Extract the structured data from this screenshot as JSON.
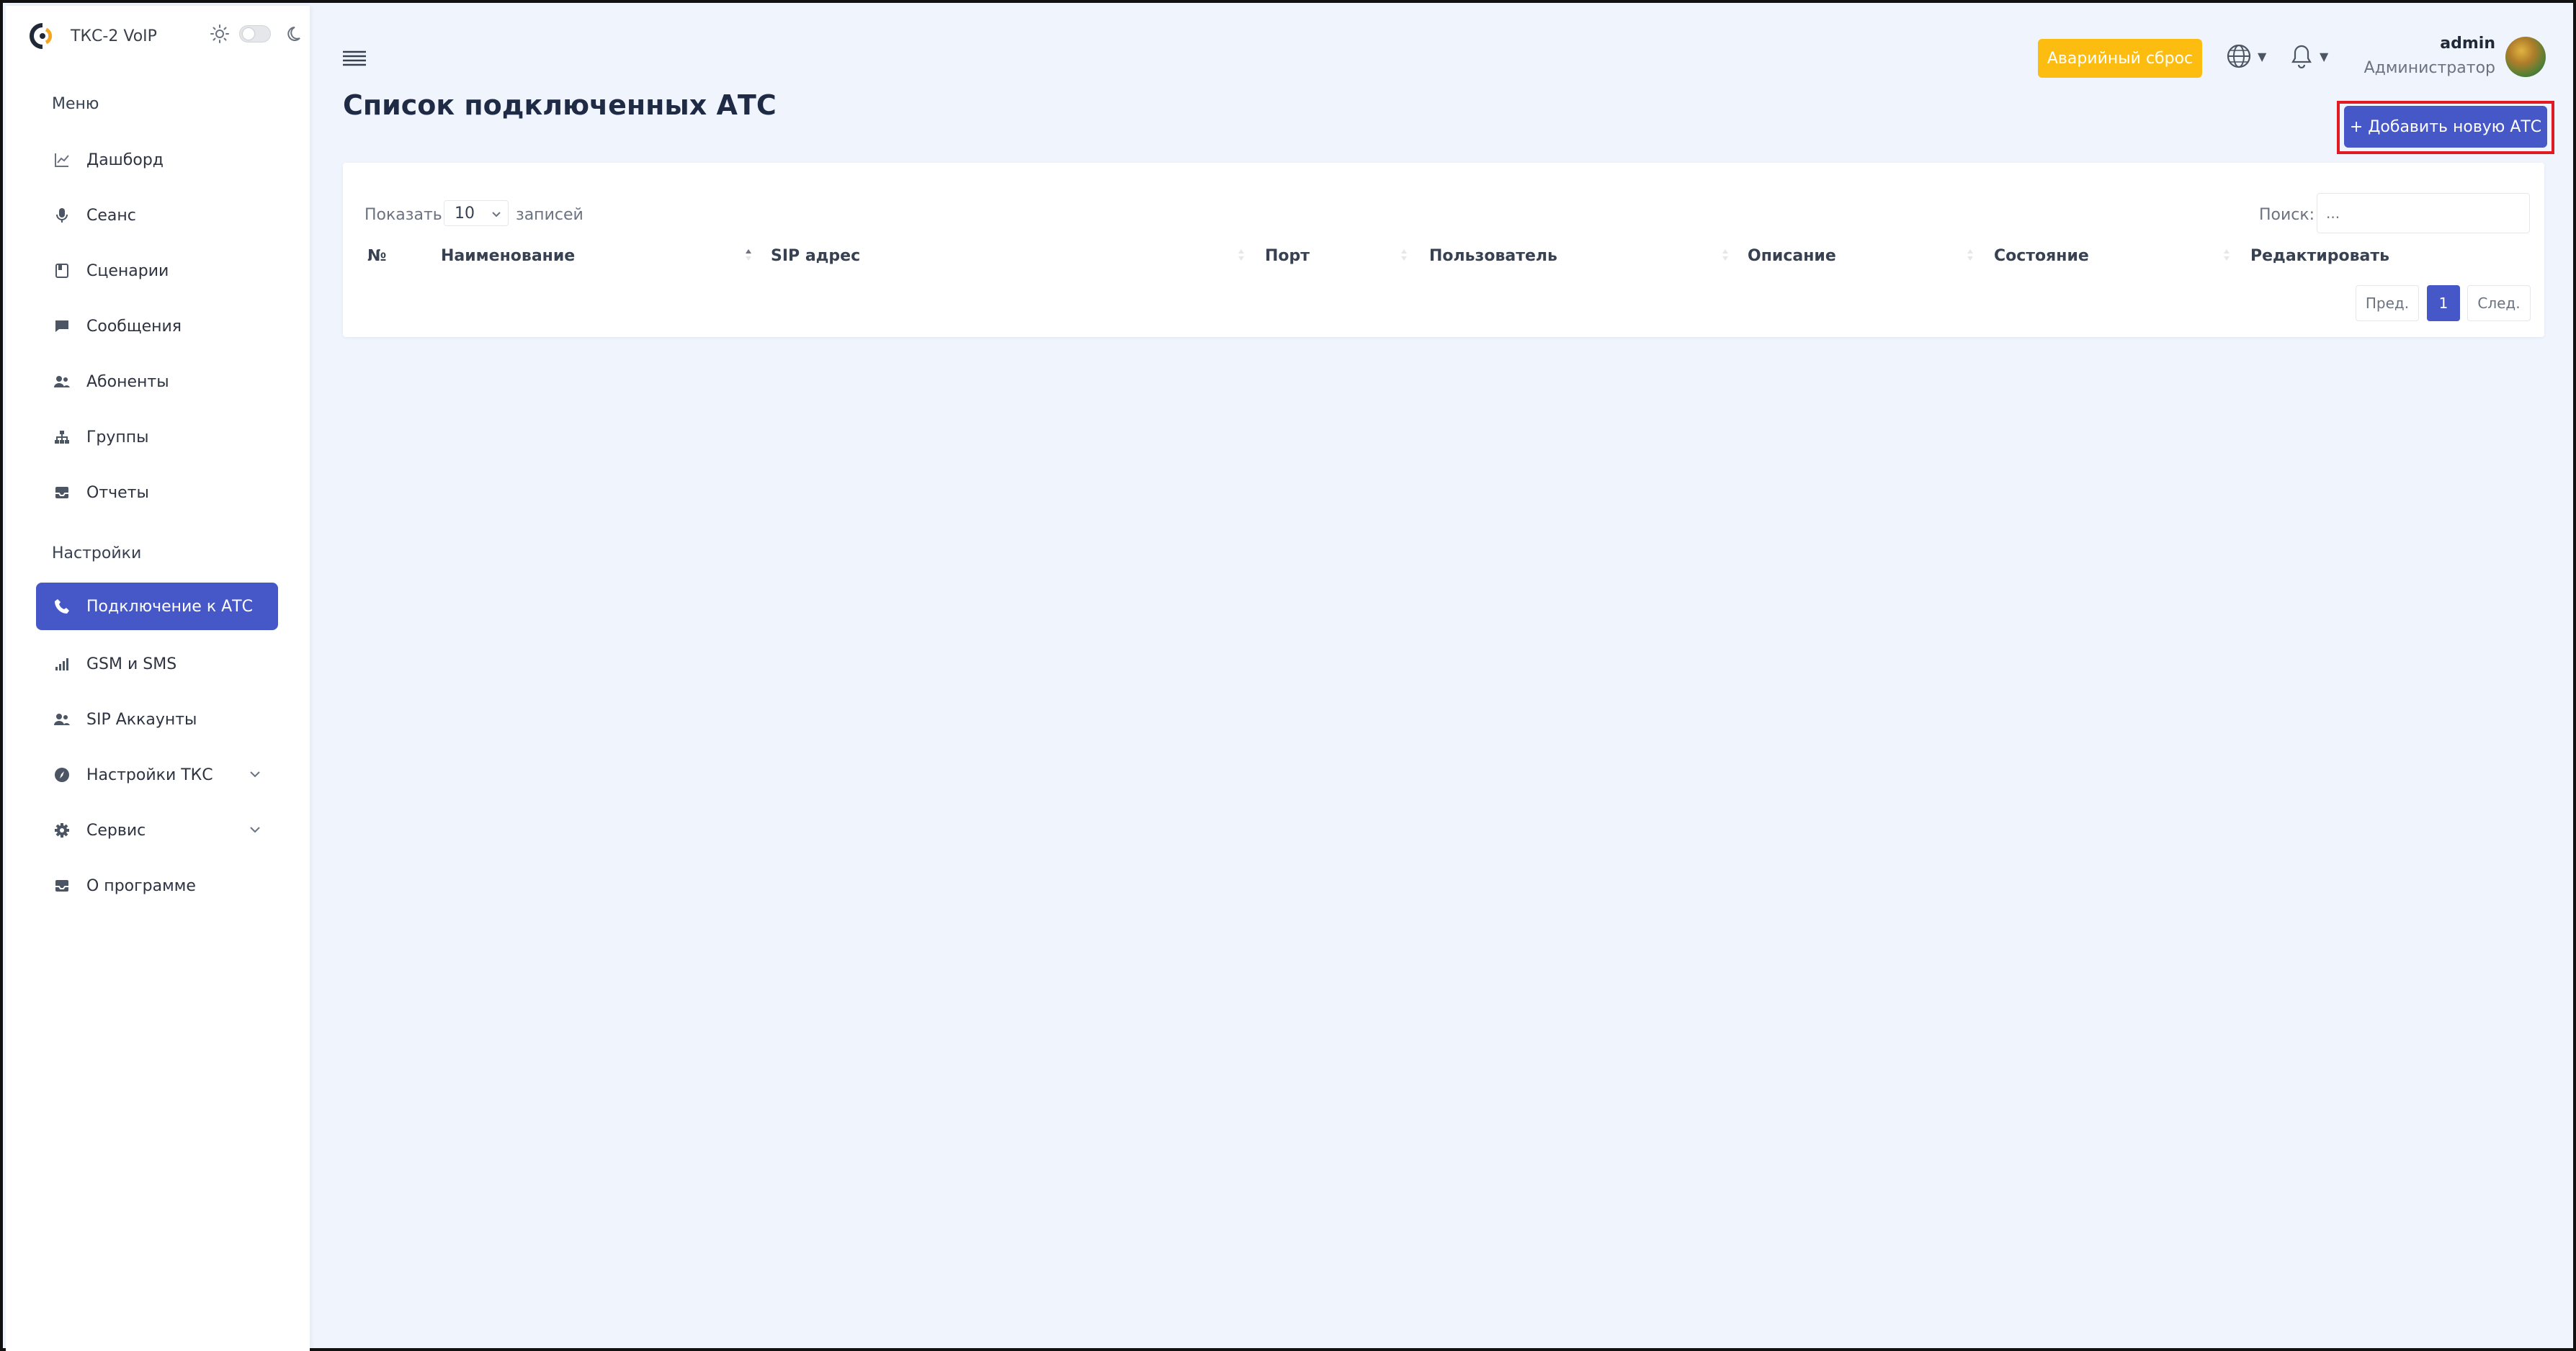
{
  "app": {
    "title": "ТКС-2 VoIP"
  },
  "sidebar": {
    "menu_label": "Меню",
    "settings_label": "Настройки",
    "items": [
      {
        "label": "Дашборд",
        "icon": "chart-line-icon"
      },
      {
        "label": "Сеанс",
        "icon": "microphone-icon"
      },
      {
        "label": "Сценарии",
        "icon": "book-icon"
      },
      {
        "label": "Сообщения",
        "icon": "message-icon"
      },
      {
        "label": "Абоненты",
        "icon": "users-icon"
      },
      {
        "label": "Группы",
        "icon": "sitemap-icon"
      },
      {
        "label": "Отчеты",
        "icon": "inbox-icon"
      }
    ],
    "settings_items": [
      {
        "label": "Подключение к АТС",
        "icon": "phone-icon",
        "active": true
      },
      {
        "label": "GSM и SMS",
        "icon": "signal-icon"
      },
      {
        "label": "SIP Аккаунты",
        "icon": "users-icon"
      },
      {
        "label": "Настройки ТКС",
        "icon": "compass-icon",
        "expandable": true
      },
      {
        "label": "Сервис",
        "icon": "gear-icon",
        "expandable": true
      },
      {
        "label": "О программе",
        "icon": "inbox-icon"
      }
    ]
  },
  "header": {
    "emergency_reset": "Аварийный сброс",
    "user": {
      "name": "admin",
      "role": "Администратор"
    }
  },
  "page": {
    "title": "Список подключенных АТС",
    "add_button": "+ Добавить новую АТС"
  },
  "table": {
    "show_label": "Показать",
    "page_length": "10",
    "records_label": "записей",
    "search_label": "Поиск:",
    "search_placeholder": "...",
    "columns": [
      "№",
      "Наименование",
      "SIP адрес",
      "Порт",
      "Пользователь",
      "Описание",
      "Состояние",
      "Редактировать"
    ],
    "pagination": {
      "prev": "Пред.",
      "current": "1",
      "next": "След."
    }
  },
  "colors": {
    "primary": "#4658c8",
    "warning": "#fdbd10",
    "highlight": "#e21b22",
    "background": "#f0f4fd"
  }
}
